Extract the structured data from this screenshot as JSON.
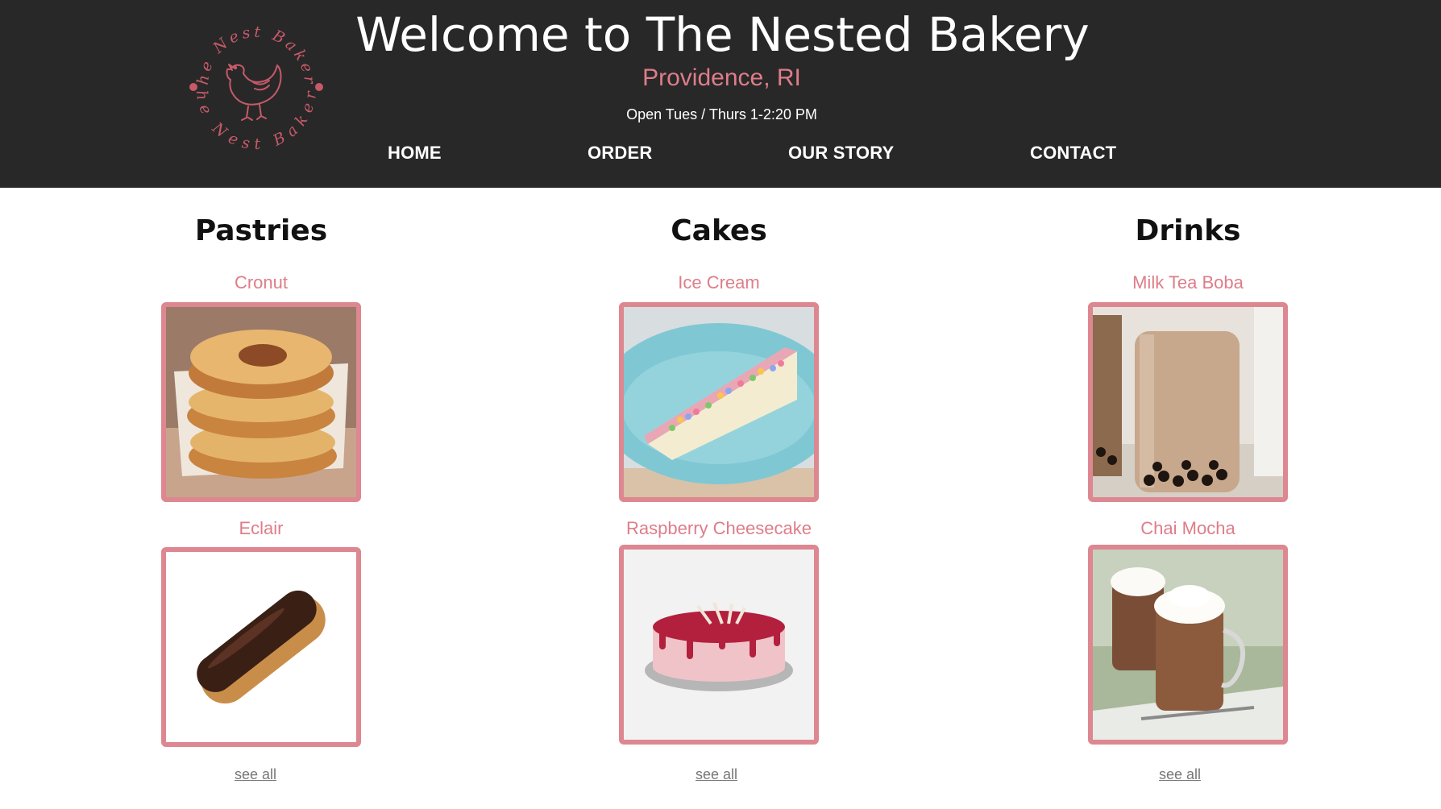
{
  "header": {
    "title": "Welcome to The Nested Bakery",
    "location": "Providence, RI",
    "hours": "Open Tues / Thurs 1-2:20 PM",
    "logo_text_top": "The Nest Bakery",
    "logo_text_bottom": "The Nest Bakery",
    "nav": [
      "HOME",
      "ORDER",
      "OUR STORY",
      "CONTACT"
    ]
  },
  "categories": [
    {
      "title": "Pastries",
      "items": [
        {
          "name": "Cronut",
          "image": "cronut-photo"
        },
        {
          "name": "Eclair",
          "image": "eclair-photo"
        }
      ],
      "see_all": "see all"
    },
    {
      "title": "Cakes",
      "items": [
        {
          "name": "Ice Cream",
          "image": "ice-cream-cake-photo"
        },
        {
          "name": "Raspberry Cheesecake",
          "image": "raspberry-cheesecake-photo"
        }
      ],
      "see_all": "see all"
    },
    {
      "title": "Drinks",
      "items": [
        {
          "name": "Milk Tea Boba",
          "image": "milk-tea-boba-photo"
        },
        {
          "name": "Chai Mocha",
          "image": "chai-mocha-photo"
        }
      ],
      "see_all": "see all"
    }
  ],
  "colors": {
    "header_bg": "#282828",
    "accent_pink": "#de7d89",
    "frame_border": "#dd8791"
  }
}
